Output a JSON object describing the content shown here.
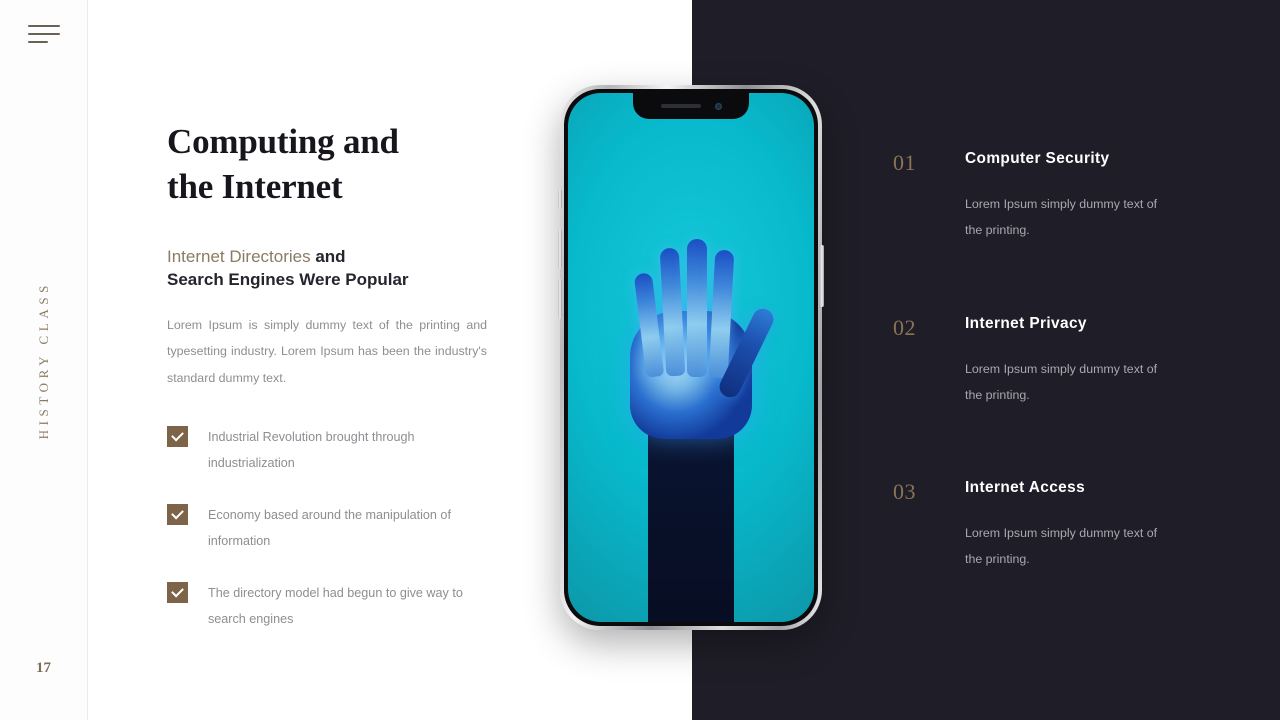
{
  "sidebar": {
    "menu_icon": "hamburger-icon",
    "vertical_label": "HISTORY CLASS",
    "page_number": "17"
  },
  "main": {
    "title_line1": "Computing and",
    "title_line2": "the Internet",
    "subtitle_accent": "Internet Directories",
    "subtitle_rest_line1": " and",
    "subtitle_line2": "Search Engines Were Popular",
    "body": "Lorem Ipsum is simply dummy text of the printing and typesetting industry.  Lorem Ipsum has been the industry's standard dummy text.",
    "checklist": [
      {
        "check_icon": "check-icon",
        "text": "Industrial Revolution brought through industrialization"
      },
      {
        "check_icon": "check-icon",
        "text": "Economy based around the manipulation of information"
      },
      {
        "check_icon": "check-icon",
        "text": "The directory model had begun to give way to search engines"
      }
    ]
  },
  "media": {
    "device": "smartphone-mockup",
    "screen_image": "blue-robotic-hand-on-teal-background"
  },
  "features": [
    {
      "number": "01",
      "title": "Computer Security",
      "desc": "Lorem Ipsum simply dummy text of the printing."
    },
    {
      "number": "02",
      "title": "Internet Privacy",
      "desc": "Lorem Ipsum simply dummy text of the printing."
    },
    {
      "number": "03",
      "title": "Internet Access",
      "desc": "Lorem Ipsum simply dummy text of the printing."
    }
  ],
  "colors": {
    "accent_brown": "#8a7b63",
    "check_brown": "#7d6449",
    "dark_panel": "#1f1d27",
    "screen_teal": "#07b9cb",
    "title_dark": "#17161c",
    "body_gray": "#8e8e93"
  }
}
